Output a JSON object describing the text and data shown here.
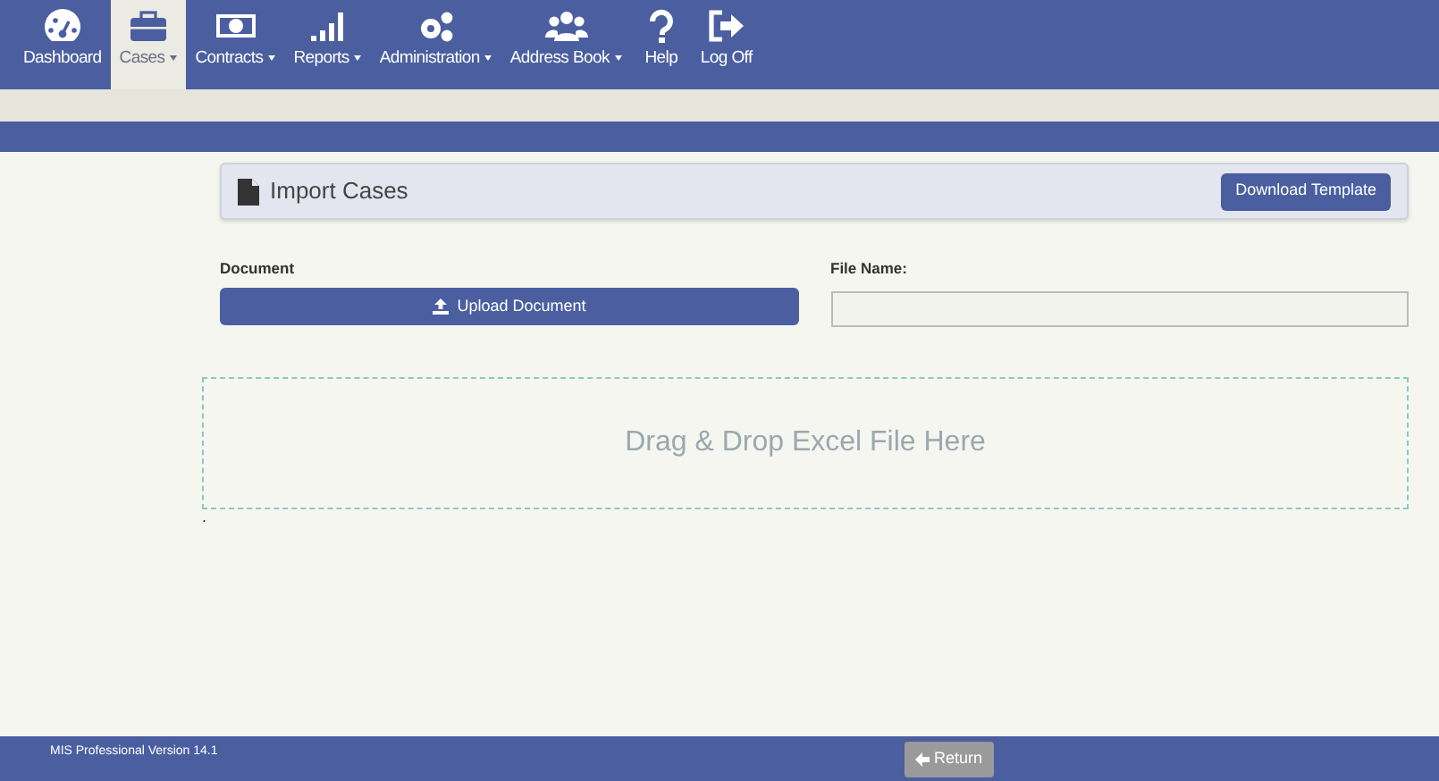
{
  "nav": [
    {
      "label": "Dashboard",
      "selected": false,
      "dropdown": false
    },
    {
      "label": "Cases",
      "selected": true,
      "dropdown": true
    },
    {
      "label": "Contracts",
      "selected": false,
      "dropdown": true
    },
    {
      "label": "Reports",
      "selected": false,
      "dropdown": true
    },
    {
      "label": "Administration",
      "selected": false,
      "dropdown": true
    },
    {
      "label": "Address Book",
      "selected": false,
      "dropdown": true
    },
    {
      "label": "Help",
      "selected": false,
      "dropdown": false
    },
    {
      "label": "Log Off",
      "selected": false,
      "dropdown": false
    }
  ],
  "panel": {
    "title": "Import Cases",
    "button": "Download Template"
  },
  "document": {
    "label": "Document",
    "button": "Upload Document"
  },
  "file_name": {
    "label": "File Name:"
  },
  "drop_zone": {
    "text": "Drag & Drop Excel File Here"
  },
  "stray_mark": ".",
  "footer": {
    "version": "MIS Professional Version 14.1",
    "button": "Return"
  }
}
